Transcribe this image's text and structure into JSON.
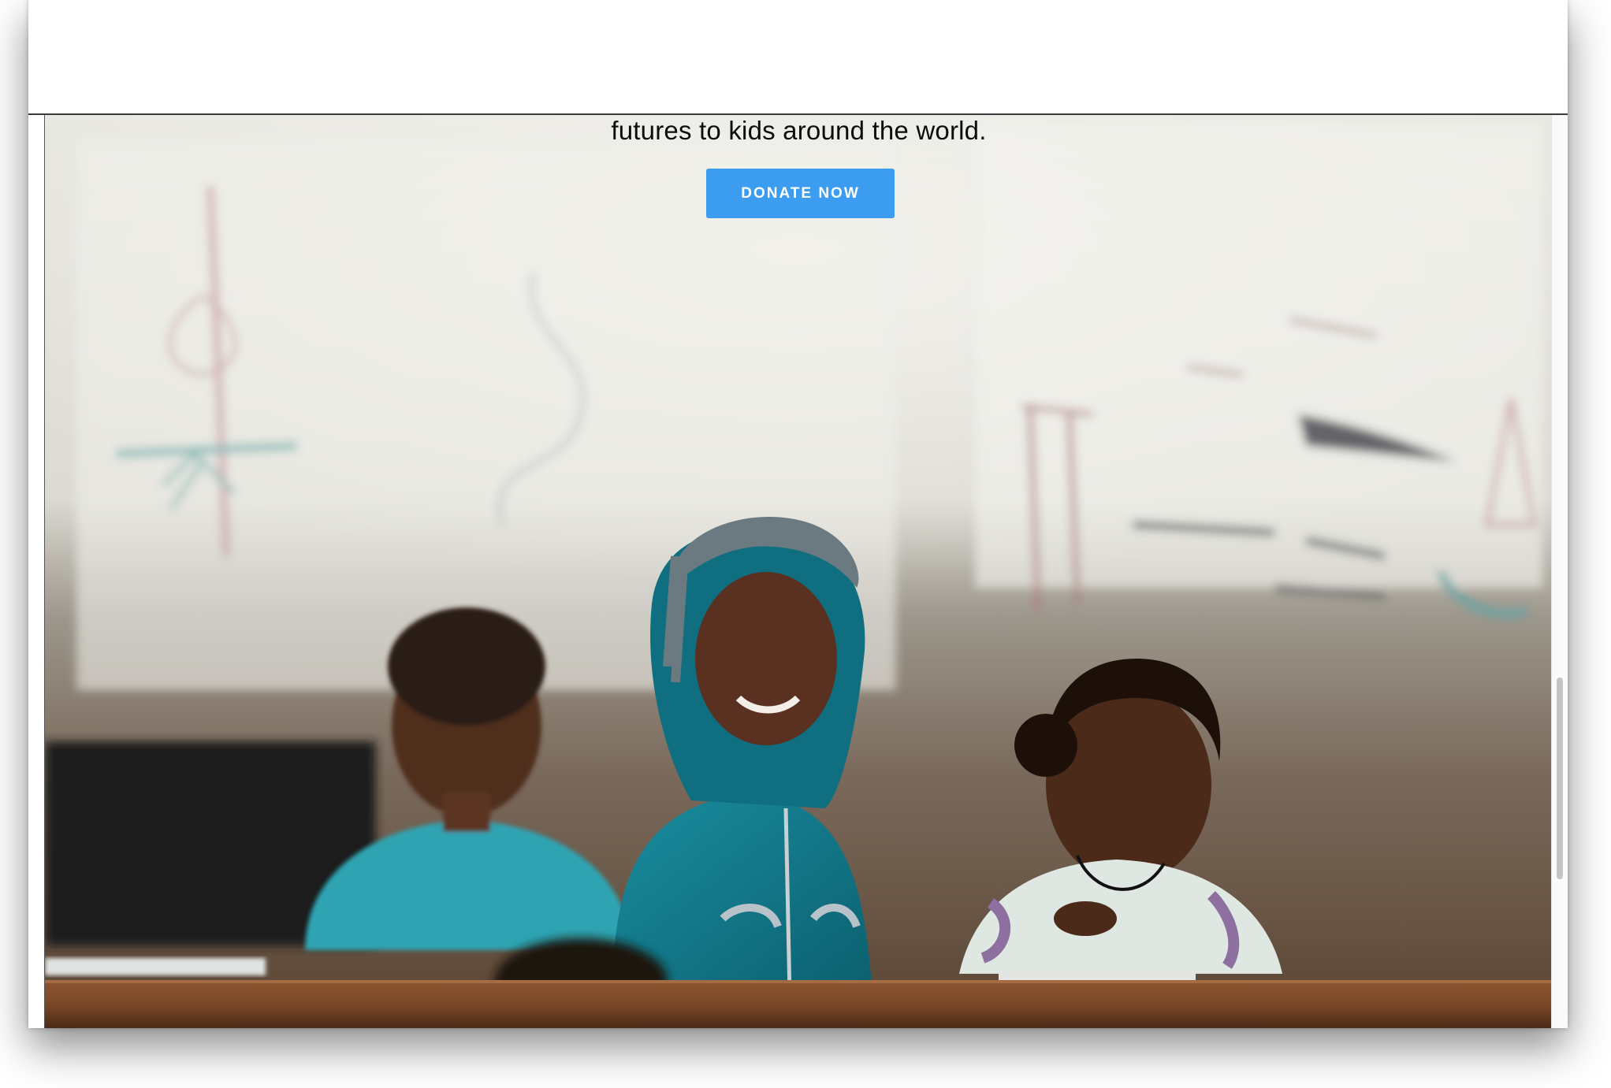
{
  "hero": {
    "headline_tail": "futures to kids around the world.",
    "cta_label": "DONATE NOW",
    "photo_description_name": "children-in-classroom-photo"
  },
  "colors": {
    "cta_background": "#3b9cf0",
    "cta_text": "#ffffff",
    "headline_text": "#0c0c0c"
  }
}
